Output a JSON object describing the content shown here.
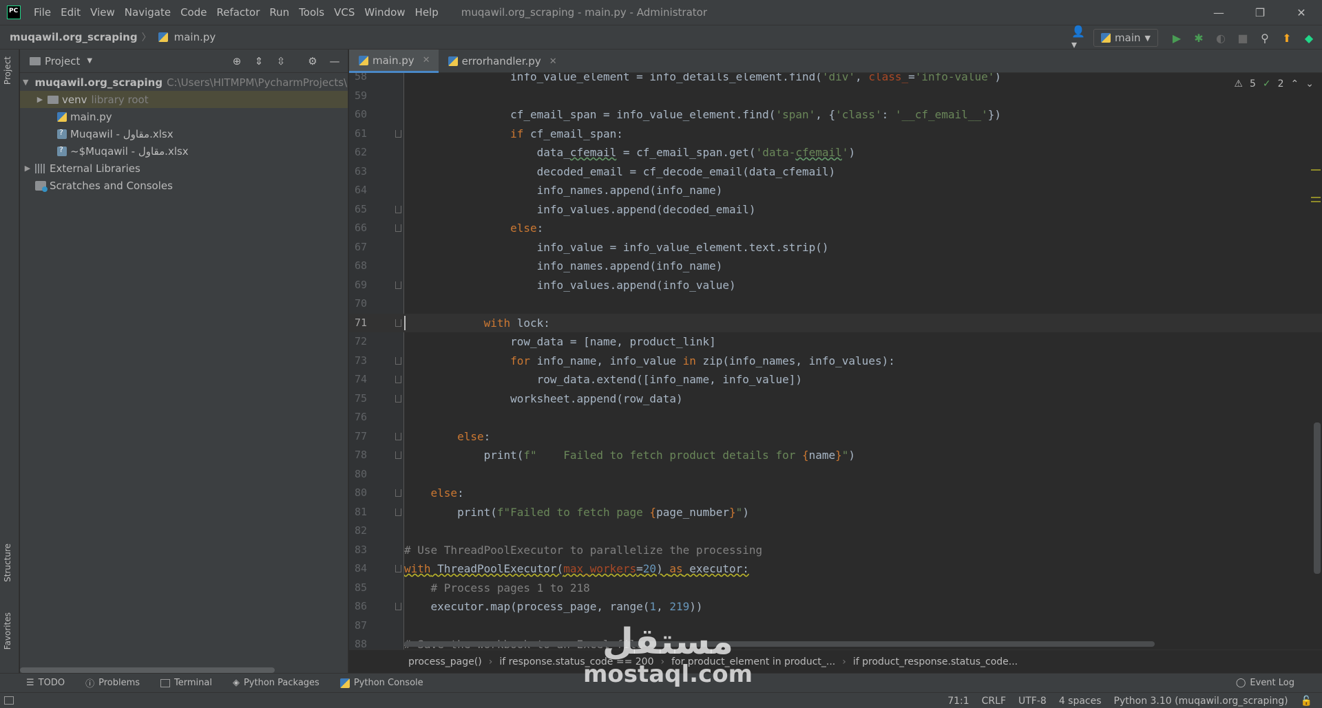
{
  "menubar": {
    "items": [
      "File",
      "Edit",
      "View",
      "Navigate",
      "Code",
      "Refactor",
      "Run",
      "Tools",
      "VCS",
      "Window",
      "Help"
    ],
    "title": "muqawil.org_scraping - main.py - Administrator",
    "controls": {
      "minimize": "—",
      "restore": "❐",
      "close": "✕"
    }
  },
  "navbar": {
    "project": "muqawil.org_scraping",
    "file": "main.py",
    "run_config": "main"
  },
  "left_strip": {
    "project": "Project",
    "structure": "Structure",
    "favorites": "Favorites"
  },
  "project_panel": {
    "title": "Project",
    "tree": [
      {
        "label": "muqawil.org_scraping",
        "sub": "C:\\Users\\HITMPM\\PycharmProjects\\muq"
      },
      {
        "label": "venv",
        "sub": "library root"
      },
      {
        "label": "main.py"
      },
      {
        "label": "Muqawil - مقاول.xlsx"
      },
      {
        "label": "~$Muqawil - مقاول.xlsx"
      },
      {
        "label": "External Libraries"
      },
      {
        "label": "Scratches and Consoles"
      }
    ]
  },
  "tabs": [
    {
      "label": "main.py",
      "active": true
    },
    {
      "label": "errorhandler.py",
      "active": false
    }
  ],
  "editor": {
    "warnings": "5",
    "typos": "2",
    "current_line": 71
  },
  "breadcrumbs": [
    "process_page()",
    "if response.status_code == 200",
    "for product_element in product_...",
    "if product_response.status_code..."
  ],
  "tool_windows": [
    "TODO",
    "Problems",
    "Terminal",
    "Python Packages",
    "Python Console"
  ],
  "event_log": "Event Log",
  "status": {
    "position": "71:1",
    "line_sep": "CRLF",
    "encoding": "UTF-8",
    "indent": "4 spaces",
    "interpreter": "Python 3.10 (muqawil.org_scraping)"
  },
  "watermark": {
    "arabic": "مستقل",
    "latin": "mostaql.com"
  },
  "colors": {
    "keyword": "#cc7832",
    "string": "#6a8759",
    "number": "#6897bb",
    "comment": "#808080",
    "param": "#aa4926",
    "accent": "#4a88c7"
  }
}
